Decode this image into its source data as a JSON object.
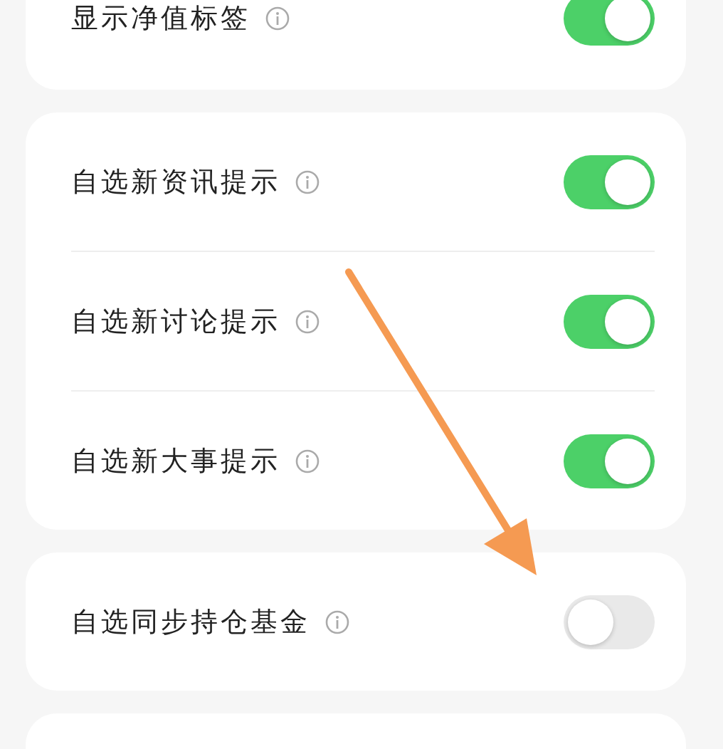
{
  "groups": [
    {
      "kind": "settings",
      "rows": [
        {
          "label": "显示净值标签",
          "on": true
        }
      ]
    },
    {
      "kind": "settings",
      "rows": [
        {
          "label": "自选新资讯提示",
          "on": true
        },
        {
          "label": "自选新讨论提示",
          "on": true
        },
        {
          "label": "自选新大事提示",
          "on": true
        }
      ]
    },
    {
      "kind": "settings",
      "rows": [
        {
          "label": "自选同步持仓基金",
          "on": false
        }
      ]
    },
    {
      "kind": "blank"
    }
  ]
}
